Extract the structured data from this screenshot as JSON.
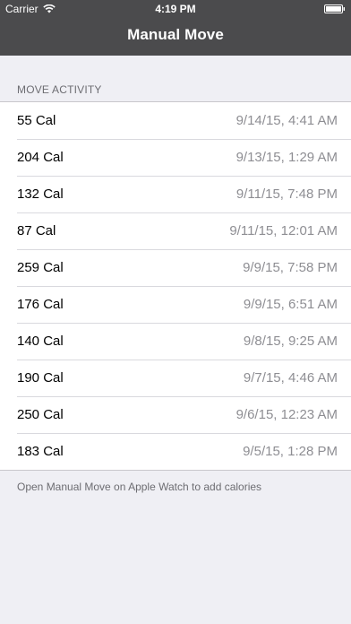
{
  "status_bar": {
    "carrier": "Carrier",
    "time": "4:19 PM"
  },
  "nav": {
    "title": "Manual Move"
  },
  "section": {
    "header": "MOVE ACTIVITY"
  },
  "rows": [
    {
      "cal": "55 Cal",
      "date": "9/14/15, 4:41 AM"
    },
    {
      "cal": "204 Cal",
      "date": "9/13/15, 1:29 AM"
    },
    {
      "cal": "132 Cal",
      "date": "9/11/15, 7:48 PM"
    },
    {
      "cal": "87 Cal",
      "date": "9/11/15, 12:01 AM"
    },
    {
      "cal": "259 Cal",
      "date": "9/9/15, 7:58 PM"
    },
    {
      "cal": "176 Cal",
      "date": "9/9/15, 6:51 AM"
    },
    {
      "cal": "140 Cal",
      "date": "9/8/15, 9:25 AM"
    },
    {
      "cal": "190 Cal",
      "date": "9/7/15, 4:46 AM"
    },
    {
      "cal": "250 Cal",
      "date": "9/6/15, 12:23 AM"
    },
    {
      "cal": "183 Cal",
      "date": "9/5/15, 1:28 PM"
    }
  ],
  "footer": {
    "text": "Open Manual Move on Apple Watch to add calories"
  },
  "colors": {
    "nav_bg": "#4b4b4d",
    "background": "#efeff4",
    "secondary_text": "#8e8e93"
  }
}
